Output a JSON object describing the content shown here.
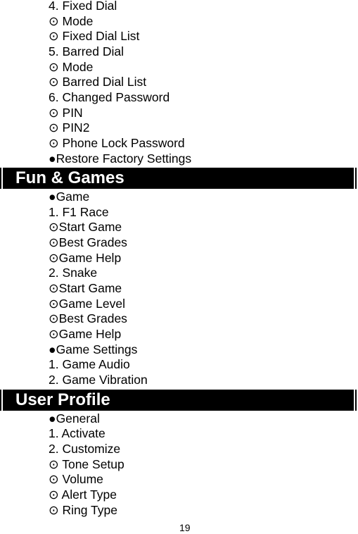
{
  "document": {
    "page_number": "19",
    "icons": {
      "bullet": "filled-circle-bullet",
      "sub_bullet": "circled-dot-bullet"
    },
    "blocks": [
      {
        "type": "line",
        "text": "4. Fixed Dial"
      },
      {
        "type": "line",
        "text": "⊙ Mode"
      },
      {
        "type": "line",
        "text": "⊙ Fixed Dial List"
      },
      {
        "type": "line",
        "text": "5. Barred Dial"
      },
      {
        "type": "line",
        "text": "⊙ Mode"
      },
      {
        "type": "line",
        "text": "⊙ Barred Dial List"
      },
      {
        "type": "line",
        "text": "6. Changed Password"
      },
      {
        "type": "line",
        "text": "⊙ PIN"
      },
      {
        "type": "line",
        "text": "⊙ PIN2"
      },
      {
        "type": "line",
        "text": "⊙ Phone Lock Password"
      },
      {
        "type": "line",
        "text": "●Restore Factory Settings"
      },
      {
        "type": "header",
        "text": "Fun & Games"
      },
      {
        "type": "line",
        "text": "●Game"
      },
      {
        "type": "line",
        "text": "1. F1 Race"
      },
      {
        "type": "line",
        "text": "⊙Start Game"
      },
      {
        "type": "line",
        "text": "⊙Best Grades"
      },
      {
        "type": "line",
        "text": "⊙Game Help"
      },
      {
        "type": "line",
        "text": "2. Snake"
      },
      {
        "type": "line",
        "text": "⊙Start Game"
      },
      {
        "type": "line",
        "text": "⊙Game Level"
      },
      {
        "type": "line",
        "text": "⊙Best Grades"
      },
      {
        "type": "line",
        "text": "⊙Game Help"
      },
      {
        "type": "line",
        "text": "●Game Settings"
      },
      {
        "type": "line",
        "text": "1. Game Audio"
      },
      {
        "type": "line",
        "text": "2. Game Vibration"
      },
      {
        "type": "header",
        "text": "User Profile"
      },
      {
        "type": "line",
        "text": "●General"
      },
      {
        "type": "line",
        "text": "1. Activate"
      },
      {
        "type": "line",
        "text": "2. Customize"
      },
      {
        "type": "line",
        "text": "⊙ Tone Setup"
      },
      {
        "type": "line",
        "text": "⊙ Volume"
      },
      {
        "type": "line",
        "text": "⊙ Alert Type"
      },
      {
        "type": "line",
        "text": "⊙ Ring Type"
      }
    ]
  }
}
